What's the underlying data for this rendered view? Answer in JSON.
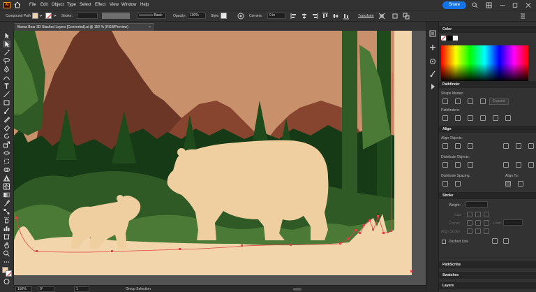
{
  "menubar": {
    "logo": "Ai",
    "items": [
      "File",
      "Edit",
      "Object",
      "Type",
      "Select",
      "Effect",
      "View",
      "Window",
      "Help"
    ],
    "share_label": "Share"
  },
  "control": {
    "selection_label": "Compound Path",
    "stroke_label": "Stroke:",
    "brush_label": "Basic",
    "opacity_label": "Opacity:",
    "opacity_value": "100%",
    "style_label": "Style:",
    "corners_label": "Corners:",
    "corners_value": "0 in",
    "transform_label": "Transform"
  },
  "document": {
    "tab_title": "Mama Bear 3D Stacked Layers [Converted].ai @ 150 % (RGB/Preview)"
  },
  "status": {
    "zoom": "150%",
    "rotation": "0°",
    "artboard": "1",
    "tool": "Group Selection"
  },
  "panels": {
    "color": {
      "title": "Color"
    },
    "pathfinder": {
      "title": "Pathfinder",
      "shape_modes": "Shape Modes:",
      "pathfinders": "Pathfinders:",
      "expand": "Expand"
    },
    "align": {
      "title": "Align",
      "objects": "Align Objects:",
      "distribute_objects": "Distribute Objects:",
      "distribute_spacing": "Distribute Spacing:",
      "align_to": "Align To:"
    },
    "stroke": {
      "title": "Stroke",
      "weight": "Weight:",
      "cap": "Cap:",
      "corner": "Corner:",
      "limit": "Limit:",
      "align_stroke": "Align Stroke:",
      "dashed": "Dashed Line"
    },
    "pathscribe": {
      "title": "PathScribe"
    },
    "swatches": {
      "title": "Swatches"
    },
    "layers": {
      "title": "Layers"
    }
  },
  "colors": {
    "sky": "#c8916c",
    "mountain_dark": "#6b3625",
    "mountain_mid": "#874530",
    "forest_dark": "#173a16",
    "forest_mid": "#2f5a25",
    "forest_light": "#4a7a35",
    "bear": "#efcfa0",
    "ground": "#f2d5ab",
    "selection": "#e5404a"
  }
}
